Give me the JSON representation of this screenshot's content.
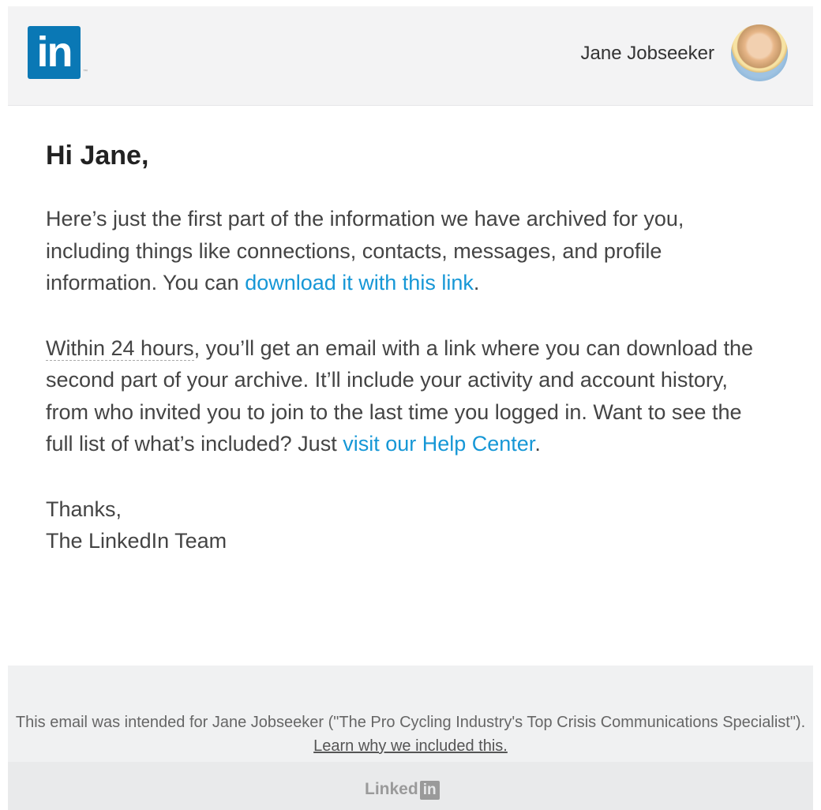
{
  "header": {
    "logo_text": "in",
    "logo_tm": "™",
    "user_name": "Jane Jobseeker"
  },
  "body": {
    "greeting": "Hi Jane,",
    "para1_text": "Here’s just the first part of the information we have archived for you, including things like connections, contacts, messages, and profile information. You can ",
    "para1_link": "download it with this link",
    "para1_end": ".",
    "para2_dotted": "Within 24 hours",
    "para2_text": ", you’ll get an email with a link where you can download the second part of your archive. It’ll include your activity and account history, from who invited you to join to the last time you logged in. Want to see the full list of what’s included? Just ",
    "para2_link": "visit our Help Center",
    "para2_end": ".",
    "thanks": "Thanks,",
    "team": "The LinkedIn Team"
  },
  "footer": {
    "text": "This email was intended for Jane Jobseeker (\"The Pro Cycling Industry's Top Crisis Communications Specialist\"). ",
    "link": "Learn why we included this.",
    "logo_text": "Linked",
    "logo_box": "in"
  },
  "colors": {
    "brand": "#0a78b5",
    "link": "#1697d6",
    "header_bg": "#f3f3f4",
    "footer_bg": "#f0f1f2"
  }
}
